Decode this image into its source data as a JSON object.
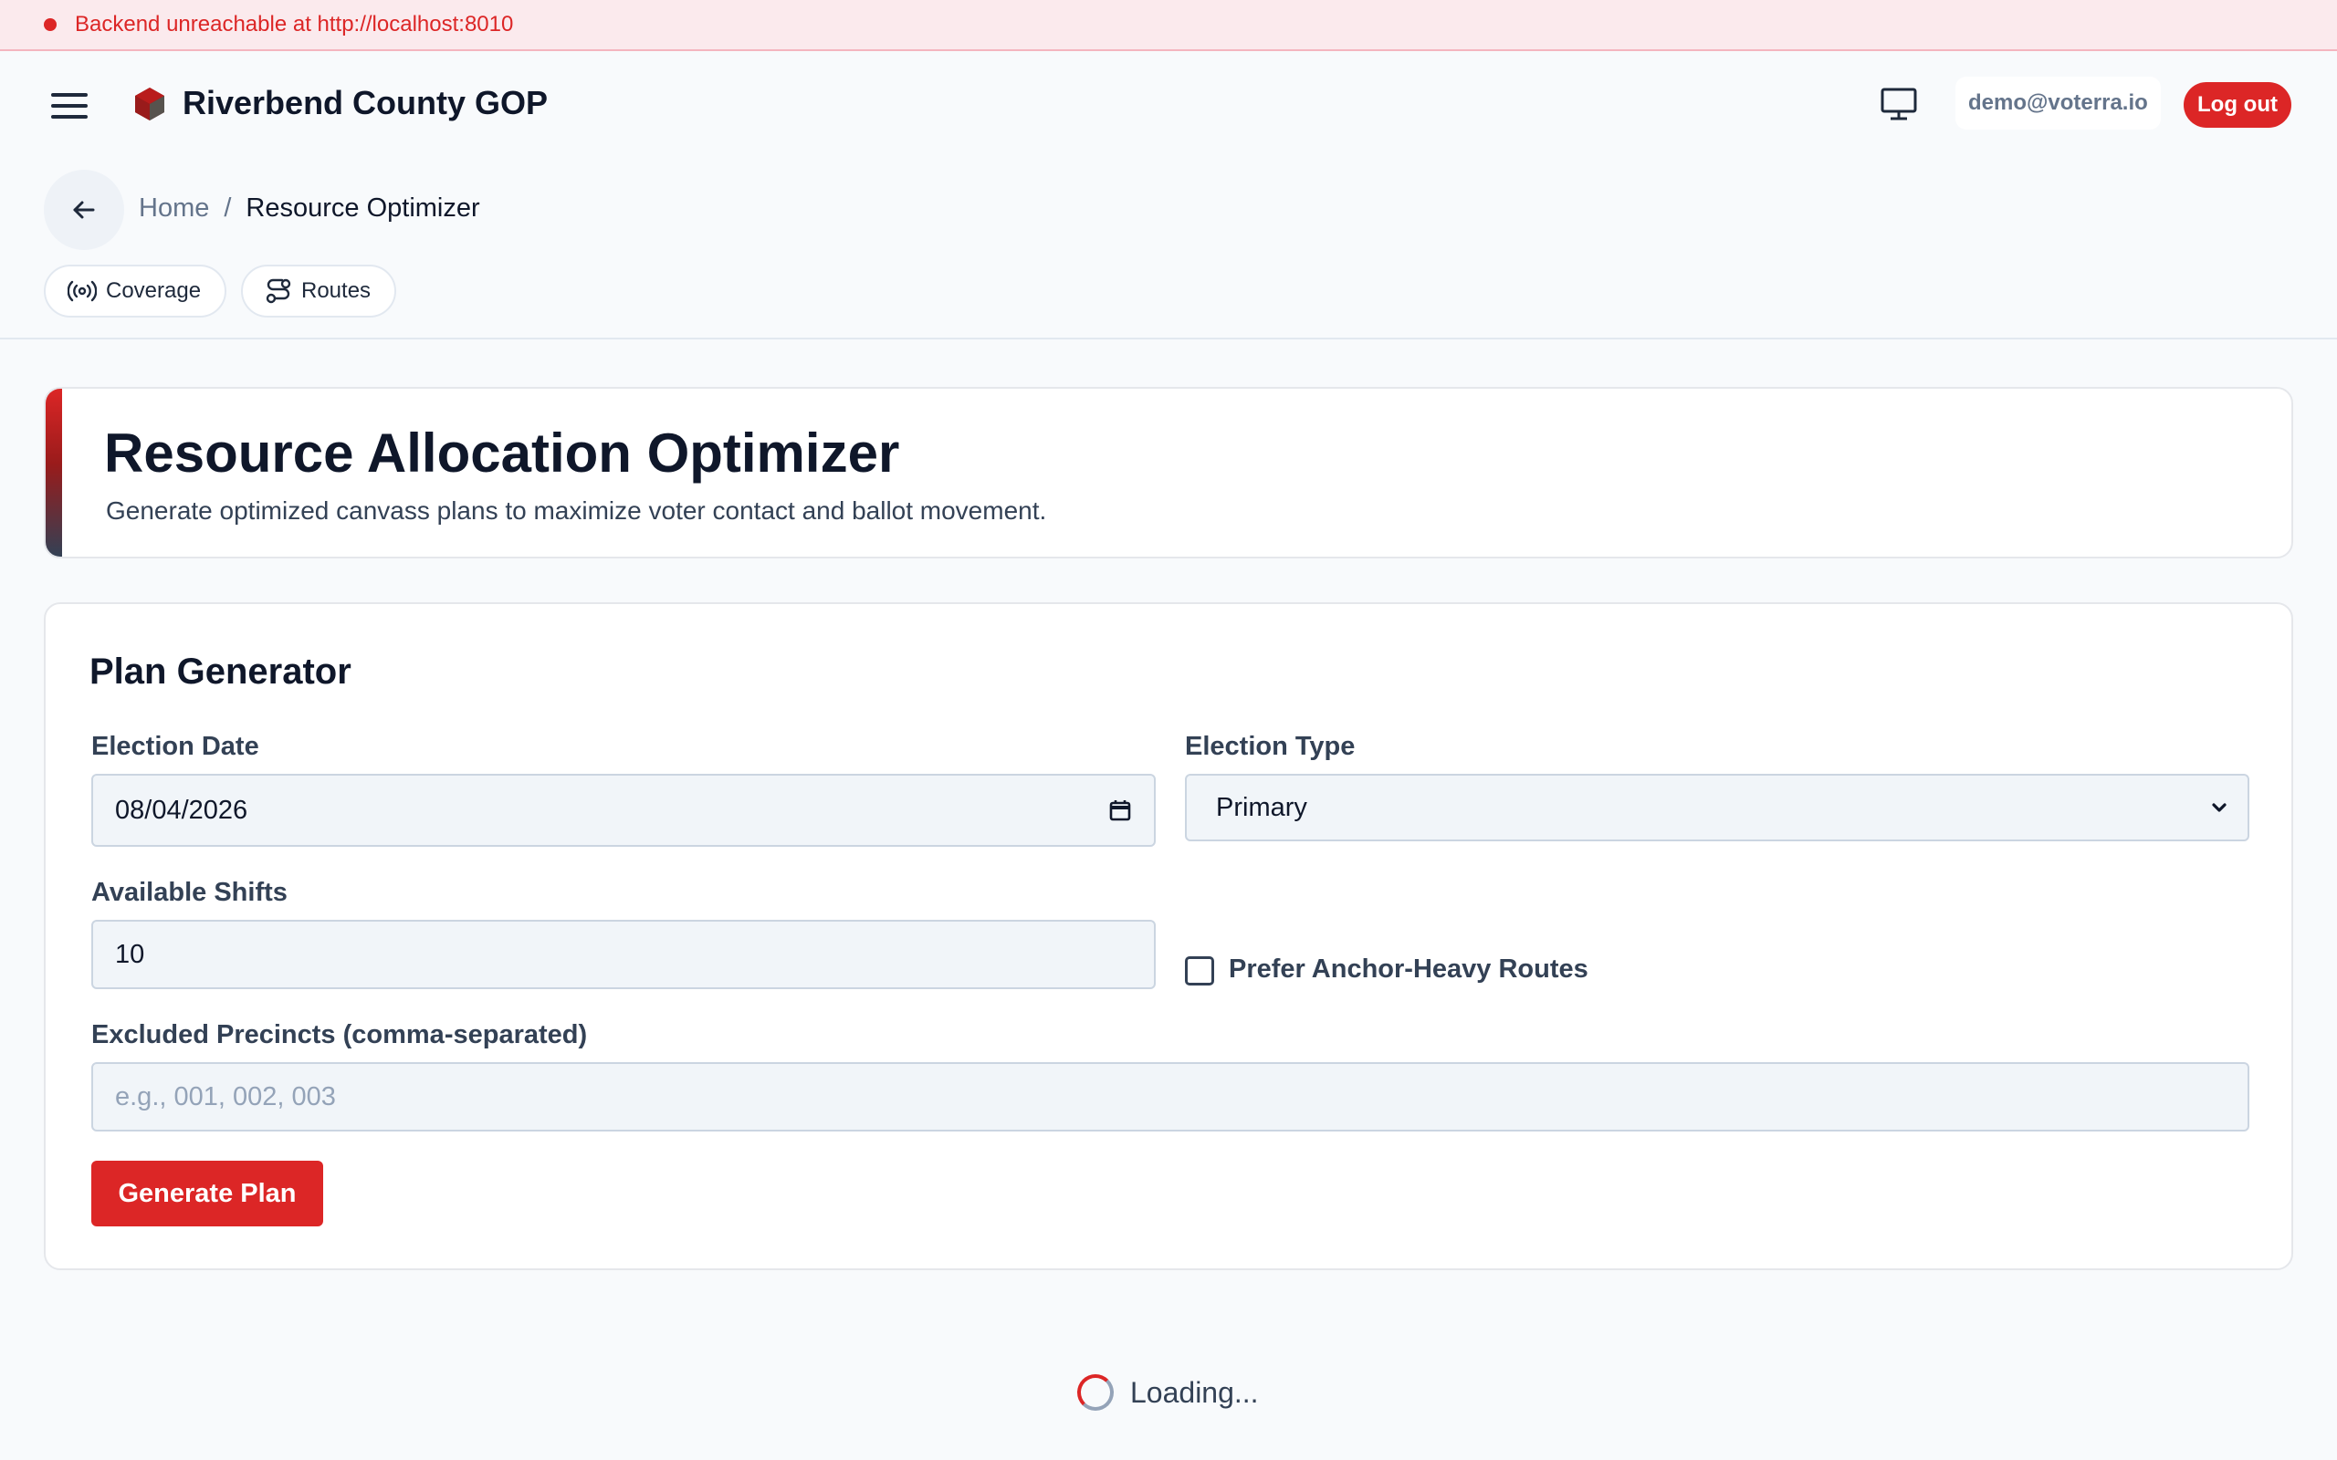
{
  "banner": {
    "message": "Backend unreachable at http://localhost:8010",
    "color": "#dc2626"
  },
  "header": {
    "app_title": "Riverbend County GOP",
    "user_email": "demo@voterra.io",
    "logout_label": "Log out",
    "brand_color": "#dc2626",
    "icons": [
      "menu-icon",
      "cube-logo-icon",
      "monitor-icon",
      "arrow-left-icon"
    ]
  },
  "breadcrumb": {
    "home": "Home",
    "separator": "/",
    "current": "Resource Optimizer"
  },
  "nav_pills": [
    {
      "label": "Coverage",
      "icon": "broadcast-icon"
    },
    {
      "label": "Routes",
      "icon": "route-icon"
    }
  ],
  "hero": {
    "title": "Resource Allocation Optimizer",
    "subtitle": "Generate optimized canvass plans to maximize voter contact and ballot movement."
  },
  "plan_generator": {
    "heading": "Plan Generator",
    "election_date": {
      "label": "Election Date",
      "value": "08/04/2026"
    },
    "election_type": {
      "label": "Election Type",
      "value": "Primary"
    },
    "available_shifts": {
      "label": "Available Shifts",
      "value": "10"
    },
    "prefer_anchor": {
      "label": "Prefer Anchor-Heavy Routes",
      "checked": false
    },
    "excluded_precincts": {
      "label": "Excluded Precincts (comma-separated)",
      "value": "",
      "placeholder": "e.g., 001, 002, 003"
    },
    "generate_label": "Generate Plan"
  },
  "status": {
    "loading_text": "Loading..."
  }
}
